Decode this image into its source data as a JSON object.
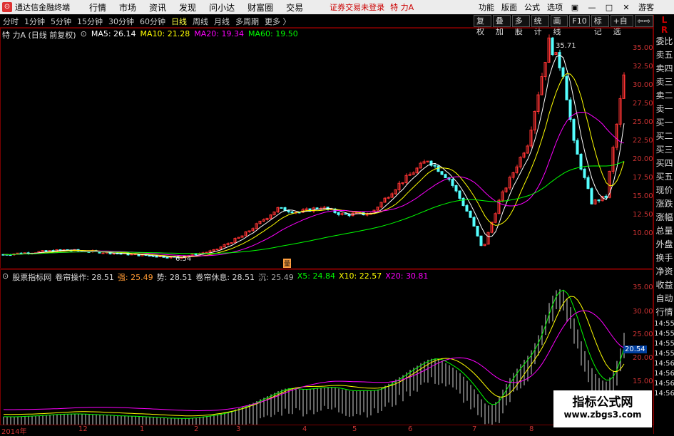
{
  "menubar": {
    "app_name": "通达信金融终端",
    "menus": [
      "行情",
      "市场",
      "资讯",
      "发现",
      "问小达",
      "财富圈",
      "交易"
    ],
    "notice": "证券交易未登录",
    "stock_name": "特 力A",
    "right_items": [
      "功能",
      "版面",
      "公式",
      "选项"
    ],
    "guest": "游客"
  },
  "toolbar": {
    "periods": [
      "分时",
      "1分钟",
      "5分钟",
      "15分钟",
      "30分钟",
      "60分钟",
      "日线",
      "周线",
      "月线",
      "多周期"
    ],
    "active": "日线",
    "more": "更多 〉",
    "buttons": [
      "复权",
      "叠加",
      "多股",
      "统计",
      "画线",
      "F10",
      "标记",
      "+自选",
      "⇦⇨"
    ]
  },
  "main_chart": {
    "title": "特 力A (日线 前复权)",
    "ma5": "MA5: 26.14",
    "ma10": "MA10: 21.28",
    "ma20": "MA20: 19.34",
    "ma60": "MA60: 19.50",
    "high_label": "35.71",
    "low_label": "6.54",
    "y_ticks": [
      "35.00",
      "32.50",
      "30.00",
      "27.50",
      "25.00",
      "22.50",
      "20.00",
      "17.50",
      "15.00",
      "12.50",
      "10.00"
    ],
    "marker": "量",
    "colors": {
      "ma5": "#ffffff",
      "ma10": "#ffff00",
      "ma20": "#ff00ff",
      "ma60": "#00ff00",
      "up": "#ff3333",
      "down": "#55ffff"
    }
  },
  "sub_chart": {
    "name": "股票指标网",
    "f1": "卷帘操作: 28.51",
    "f2": "强: 25.49",
    "f3": "势: 28.51",
    "f4": "卷帘休息: 28.51",
    "f5": "沉: 25.49",
    "f6": "X5: 24.84",
    "f7": "X10: 22.57",
    "f8": "X20: 30.81",
    "y_ticks": [
      "35.00",
      "30.00",
      "25.00",
      "20.00",
      "15.00"
    ],
    "current_value": "20.54"
  },
  "x_axis": [
    "2014年",
    "12",
    "1",
    "2",
    "3",
    "4",
    "5",
    "6",
    "7",
    "8"
  ],
  "side_panel": [
    "L",
    "R",
    "委比",
    "卖五",
    "卖四",
    "卖三",
    "卖二",
    "卖一",
    "买一",
    "买二",
    "买三",
    "买四",
    "买五",
    "现价",
    "涨跌",
    "涨幅",
    "总量",
    "外盘",
    "换手",
    "净资",
    "收益",
    "自动",
    "行情",
    "14:55",
    "14:55",
    "14:55",
    "14:55",
    "14:56",
    "14:56",
    "14:56",
    "14:56"
  ],
  "watermark": {
    "line1": "指标公式网",
    "line2": "www.zbgs3.com"
  }
}
